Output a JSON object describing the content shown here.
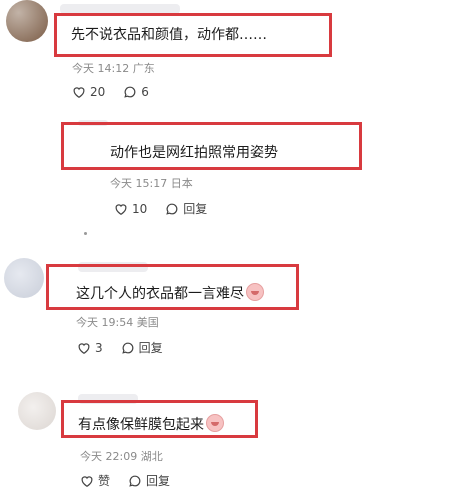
{
  "comments": [
    {
      "text": "先不说衣品和颜值，动作都……",
      "meta": "今天 14:12 广东",
      "likes": "20",
      "replies": "6"
    },
    {
      "text": "动作也是网红拍照常用姿势",
      "meta": "今天 15:17 日本",
      "likes": "10",
      "reply_label": "回复"
    },
    {
      "text": "这几个人的衣品都一言难尽",
      "meta": "今天 19:54 美国",
      "likes": "3",
      "reply_label": "回复"
    },
    {
      "text": "有点像保鲜膜包起来",
      "meta": "今天 22:09 湖北",
      "likes": "赞",
      "reply_label": "回复"
    }
  ],
  "colors": {
    "highlight": "#d83a3f",
    "meta": "#8a8a8a"
  },
  "icons": [
    "heart-icon",
    "comment-bubble-icon",
    "emoji-icon"
  ]
}
